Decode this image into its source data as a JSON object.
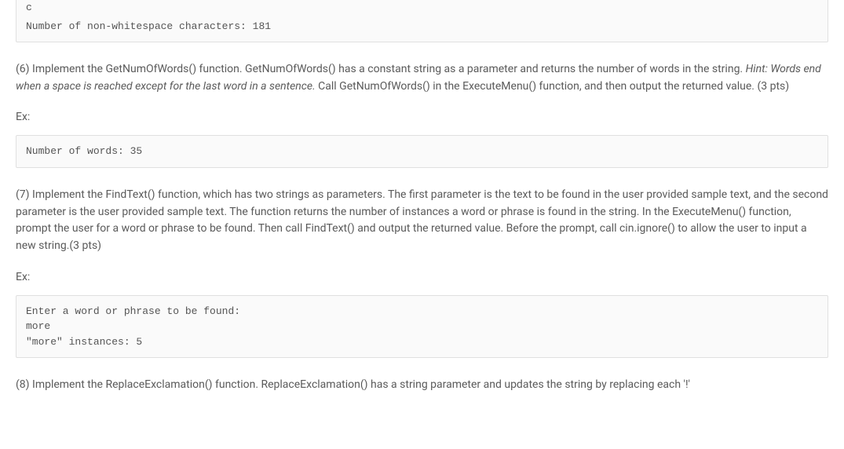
{
  "code_fragment_c": "c",
  "code_block_1": "Number of non-whitespace characters: 181",
  "para_6_part1": "(6) Implement the GetNumOfWords() function. GetNumOfWords() has a constant string as a parameter and returns the number of words in the string. ",
  "para_6_hint": "Hint: Words end when a space is reached except for the last word in a sentence.",
  "para_6_part2": " Call GetNumOfWords() in the ExecuteMenu() function, and then output the returned value. (3 pts)",
  "ex_label_1": "Ex:",
  "code_block_2": "Number of words: 35",
  "para_7": "(7) Implement the FindText() function, which has two strings as parameters. The first parameter is the text to be found in the user provided sample text, and the second parameter is the user provided sample text. The function returns the number of instances a word or phrase is found in the string. In the ExecuteMenu() function, prompt the user for a word or phrase to be found. Then call FindText() and output the returned value. Before the prompt, call cin.ignore() to allow the user to input a new string.(3 pts)",
  "ex_label_2": "Ex:",
  "code_block_3": "Enter a word or phrase to be found:\nmore\n\"more\" instances: 5",
  "para_8": "(8) Implement the ReplaceExclamation() function. ReplaceExclamation() has a string parameter and updates the string by replacing each '!'"
}
